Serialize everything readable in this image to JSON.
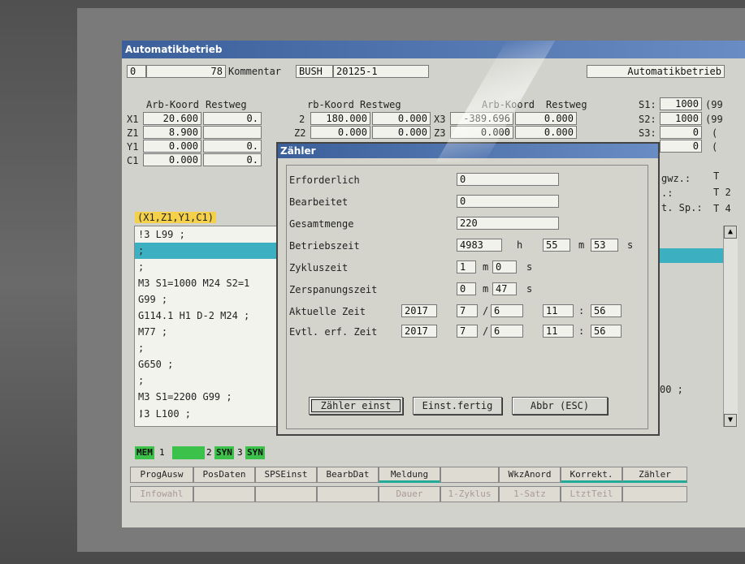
{
  "window": {
    "title": "Automatikbetrieb"
  },
  "header": {
    "channel": "0",
    "program_no": "78",
    "comment_label": "Kommentar",
    "comment_value": "BUSH",
    "comment_value_tail": "20125-1",
    "mode": "Automatikbetrieb"
  },
  "axes": {
    "col_headers": [
      "Arb-Koord",
      "Restweg"
    ],
    "group1": [
      {
        "axis": "X1",
        "coord": "20.600",
        "rest": "0."
      },
      {
        "axis": "Z1",
        "coord": "8.900",
        "rest": ""
      },
      {
        "axis": "Y1",
        "coord": "0.000",
        "rest": "0."
      },
      {
        "axis": "C1",
        "coord": "0.000",
        "rest": "0."
      }
    ],
    "group2_header": "rb-Koord Restweg",
    "group2": [
      {
        "axis": "2",
        "coord": "180.000",
        "rest": "0.000"
      },
      {
        "axis": "Z2",
        "coord": "0.000",
        "rest": "0.000"
      }
    ],
    "group3": [
      {
        "axis": "X3",
        "coord": "-389.696",
        "rest": "0.000"
      },
      {
        "axis": "Z3",
        "coord": "0.000",
        "rest": "0.000"
      }
    ],
    "spindles": [
      {
        "name": "S1:",
        "value": "1000",
        "extra": "(99"
      },
      {
        "name": "S2:",
        "value": "1000",
        "extra": "(99"
      },
      {
        "name": "S3:",
        "value": "0",
        "extra": "("
      },
      {
        "name": "",
        "value": "0",
        "extra": "("
      }
    ]
  },
  "right_info": {
    "l1": "gwz.:",
    "l2": ".:",
    "l3": "t. Sp.:",
    "t1": "T",
    "t2": "T 2",
    "t3": "T 4"
  },
  "axis_group_label": "(X1,Z1,Y1,C1)",
  "program_lines": [
    "!3 L99 ;",
    ";",
    ";",
    "M3 S1=1000 M24 S2=1",
    "G99 ;",
    "G114.1 H1 D-2 M24 ;",
    "M77 ;",
    ";",
    "G650 ;",
    ";",
    "M3 S1=2200 G99 ;",
    ";",
    "!3 L100 ;"
  ],
  "right_program_fragment": "00 ;",
  "dialog": {
    "title": "Zähler",
    "fields": {
      "erforderlich": {
        "label": "Erforderlich",
        "value": "0"
      },
      "bearbeitet": {
        "label": "Bearbeitet",
        "value": "0"
      },
      "gesamtmenge": {
        "label": "Gesamtmenge",
        "value": "220"
      },
      "betriebszeit": {
        "label": "Betriebszeit",
        "h": "4983",
        "h_unit": "h",
        "m": "55",
        "m_unit": "m",
        "s": "53",
        "s_unit": "s"
      },
      "zykluszeit": {
        "label": "Zykluszeit",
        "m": "1",
        "m_unit": "m",
        "s": "0",
        "s_unit": "s"
      },
      "zerspanungszeit": {
        "label": "Zerspanungszeit",
        "m": "0",
        "m_unit": "m",
        "s": "47",
        "s_unit": "s"
      },
      "aktuelle_zeit": {
        "label": "Aktuelle Zeit",
        "year": "2017",
        "month": "7",
        "sep": "/",
        "day": "6",
        "hour": "11",
        "colon": ":",
        "minute": "56"
      },
      "evtl_zeit": {
        "label": "Evtl. erf. Zeit",
        "year": "2017",
        "month": "7",
        "sep": "/",
        "day": "6",
        "hour": "11",
        "colon": ":",
        "minute": "56"
      }
    },
    "buttons": {
      "set": "Zähler einst",
      "done": "Einst.fertig",
      "cancel": "Abbr (ESC)"
    }
  },
  "status_bar": {
    "mem": "MEM",
    "n1": "1",
    "n2": "2",
    "syn1": "SYN",
    "n3": "3",
    "syn2": "SYN"
  },
  "softkeys_row1": [
    "ProgAusw",
    "PosDaten",
    "SPSEinst",
    "BearbDat",
    "Meldung",
    "",
    "WkzAnord",
    "Korrekt.",
    "Zähler"
  ],
  "softkeys_row2": [
    "Infowahl",
    "",
    "",
    "",
    "Dauer",
    "1-Zyklus",
    "1-Satz",
    "LtztTeil",
    ""
  ],
  "colors": {
    "titlebar": "#3a5f9a",
    "highlight": "#3cb0c0",
    "status_green": "#3cc24a",
    "axis_label": "#f5d14a"
  }
}
